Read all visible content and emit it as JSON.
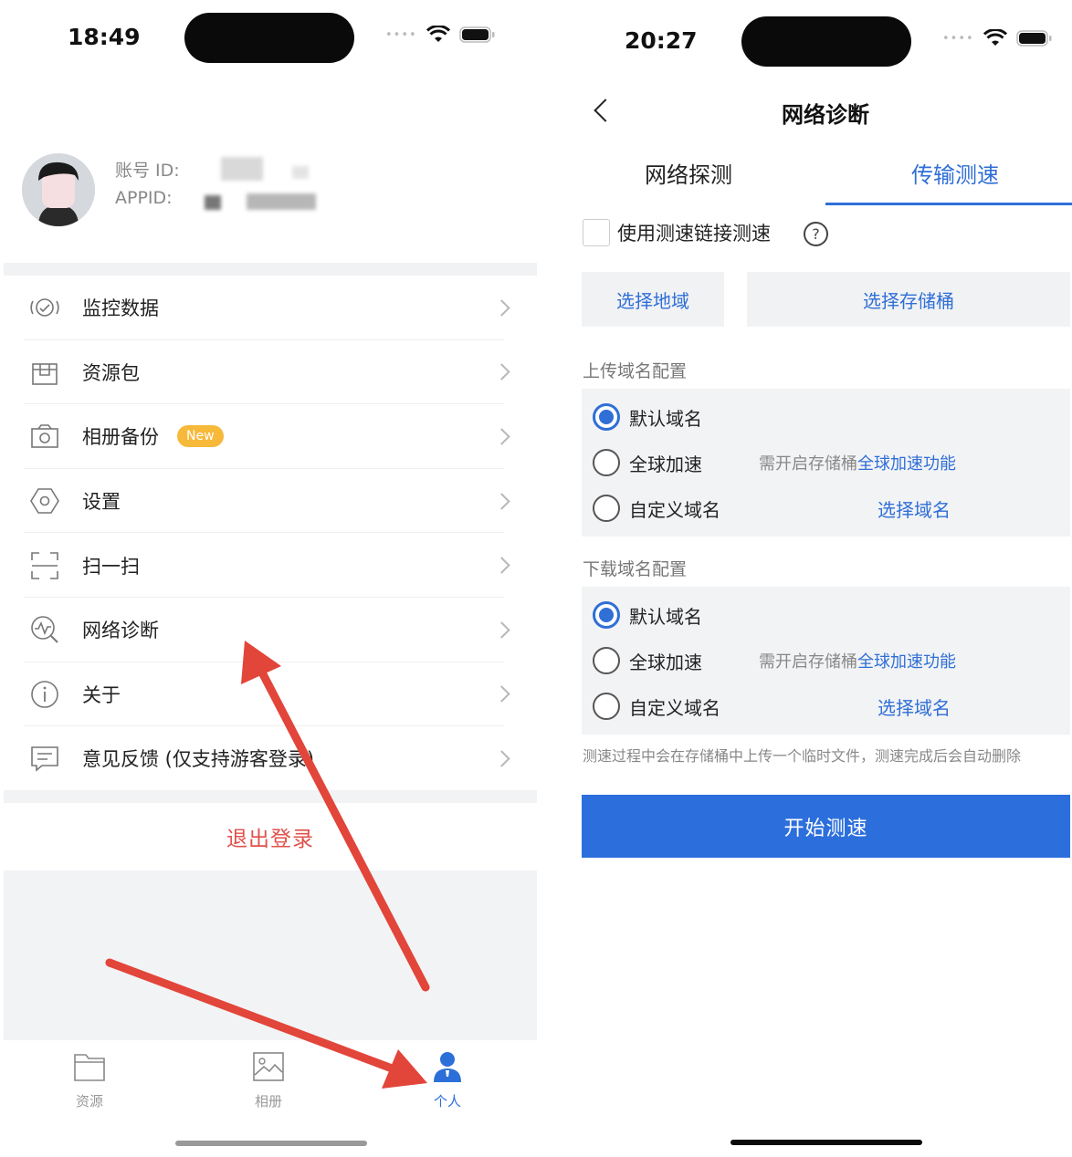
{
  "left": {
    "status": {
      "time": "18:49"
    },
    "profile": {
      "account_label": "账号 ID:",
      "appid_label": "APPID:"
    },
    "menu": [
      {
        "label": "监控数据",
        "icon": "monitor-gauge-icon"
      },
      {
        "label": "资源包",
        "icon": "package-box-icon"
      },
      {
        "label": "相册备份",
        "icon": "camera-icon",
        "badge": "New"
      },
      {
        "label": "设置",
        "icon": "hexagon-settings-icon"
      },
      {
        "label": "扫一扫",
        "icon": "scan-icon"
      },
      {
        "label": "网络诊断",
        "icon": "network-diagnosis-icon"
      },
      {
        "label": "关于",
        "icon": "info-icon"
      },
      {
        "label": "意见反馈 (仅支持游客登录)",
        "icon": "feedback-icon"
      }
    ],
    "logout": "退出登录",
    "tabs": [
      {
        "label": "资源",
        "icon": "folder-icon",
        "active": false
      },
      {
        "label": "相册",
        "icon": "image-icon",
        "active": false
      },
      {
        "label": "个人",
        "icon": "person-icon",
        "active": true
      }
    ],
    "colors": {
      "accent": "#2d6fd8",
      "logout": "#e0504b",
      "badge": "#f6b93a",
      "arrow": "#e2453a"
    }
  },
  "right": {
    "status": {
      "time": "20:27"
    },
    "title": "网络诊断",
    "tabs": [
      {
        "label": "网络探测",
        "active": false
      },
      {
        "label": "传输测速",
        "active": true
      }
    ],
    "checkbox_label": "使用测速链接测速",
    "buttons": {
      "region": "选择地域",
      "bucket": "选择存储桶"
    },
    "upload": {
      "title": "上传域名配置",
      "options": [
        {
          "label": "默认域名",
          "selected": true
        },
        {
          "label": "全球加速",
          "selected": false,
          "note": "需开启存储桶",
          "note_link": "全球加速功能"
        },
        {
          "label": "自定义域名",
          "selected": false,
          "link": "选择域名"
        }
      ]
    },
    "download": {
      "title": "下载域名配置",
      "options": [
        {
          "label": "默认域名",
          "selected": true
        },
        {
          "label": "全球加速",
          "selected": false,
          "note": "需开启存储桶",
          "note_link": "全球加速功能"
        },
        {
          "label": "自定义域名",
          "selected": false,
          "link": "选择域名"
        }
      ]
    },
    "notice": "测速过程中会在存储桶中上传一个临时文件，测速完成后会自动删除",
    "start_button": "开始测速",
    "colors": {
      "accent": "#2c6fdc"
    }
  }
}
